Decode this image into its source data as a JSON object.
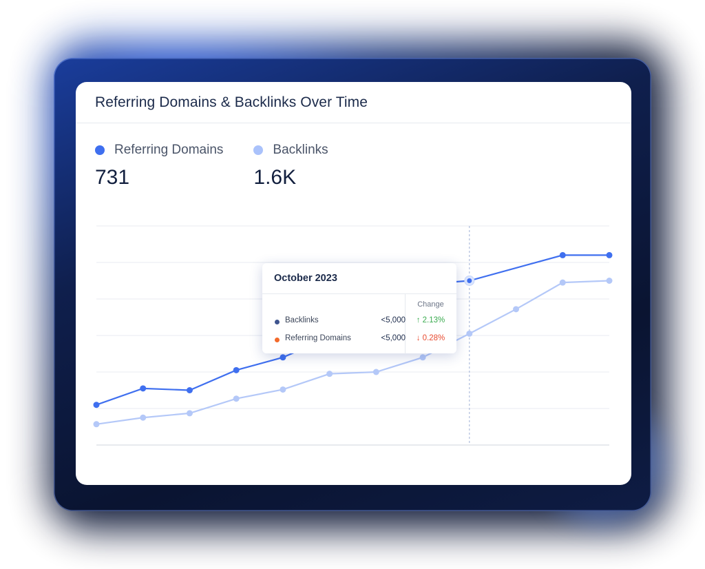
{
  "card": {
    "title": "Referring Domains & Backlinks Over Time"
  },
  "legend": [
    {
      "label": "Referring Domains",
      "value": "731",
      "color": "#3f6fef"
    },
    {
      "label": "Backlinks",
      "value": "1.6K",
      "color": "#aac2fb"
    }
  ],
  "tooltip": {
    "title": "October 2023",
    "change_header": "Change",
    "rows": [
      {
        "label": "Backlinks",
        "value": "<5,000",
        "change": "↑ 2.13%",
        "dot_color": "#3f558f",
        "change_color": "#3aab4f"
      },
      {
        "label": "Referring Domains",
        "value": "<5,000",
        "change": "↓ 0.28%",
        "dot_color": "#f36a2b",
        "change_color": "#e84a2f"
      }
    ]
  },
  "chart_data": {
    "type": "line",
    "gridlines": 7,
    "grid": true,
    "highlight_index": 8,
    "series": [
      {
        "name": "Referring Domains",
        "color": "#3f6fef",
        "values": [
          1.1,
          1.55,
          1.5,
          2.05,
          2.4,
          2.95,
          3.95,
          4.4,
          4.5,
          5.2,
          5.2
        ]
      },
      {
        "name": "Backlinks",
        "color": "#b4c8f8",
        "values": [
          0.57,
          0.75,
          0.87,
          1.27,
          1.52,
          1.95,
          2.0,
          2.4,
          3.05,
          3.72,
          4.45,
          4.5
        ]
      }
    ]
  }
}
